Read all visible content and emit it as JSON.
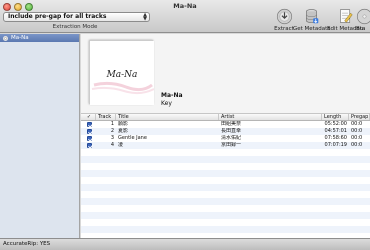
{
  "window": {
    "title": "Ma-Na"
  },
  "toolbar": {
    "mode_value": "Include pre-gap for all tracks",
    "mode_caption": "Extraction Mode",
    "buttons": [
      {
        "label": "Extract",
        "icon": "extract-disc-icon"
      },
      {
        "label": "Get Metadata",
        "icon": "database-icon"
      },
      {
        "label": "Edit Metadata",
        "icon": "edit-document-icon"
      },
      {
        "label": "Bu",
        "icon": "burn-icon"
      }
    ]
  },
  "sidebar": {
    "items": [
      {
        "label": "Ma-Na",
        "icon": "disc-icon"
      }
    ]
  },
  "album": {
    "cover_text": "Ma-Na",
    "title": "Ma-Na",
    "artist": "Key"
  },
  "tracks": {
    "columns": [
      "✓",
      "Track",
      "Title",
      "Artist",
      "Length",
      "Pregap"
    ],
    "rows": [
      {
        "checked": true,
        "num": "1",
        "title": "願影",
        "artist": "田組美奈",
        "length": "05:52:00",
        "pregap": "00:0"
      },
      {
        "checked": true,
        "num": "2",
        "title": "夏影",
        "artist": "長田直幸",
        "length": "04:57:01",
        "pregap": "00:0"
      },
      {
        "checked": true,
        "num": "3",
        "title": "Gentle Jane",
        "artist": "清水佑紀",
        "length": "07:58:60",
        "pregap": "00:0"
      },
      {
        "checked": true,
        "num": "4",
        "title": "凌",
        "artist": "京田録一",
        "length": "07:07:19",
        "pregap": "00:0"
      }
    ]
  },
  "status": {
    "text": "AccurateRip: YES"
  },
  "colors": {
    "accent": "#3a63b8",
    "sidebar_selected": "#6a86bc"
  }
}
